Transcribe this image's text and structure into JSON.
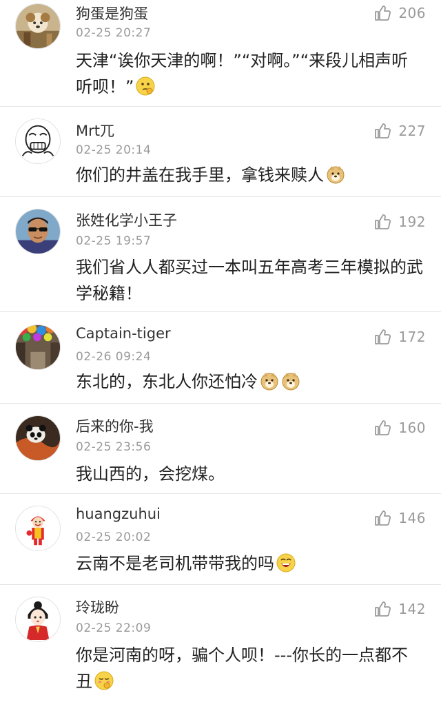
{
  "comments": [
    {
      "username": "狗蛋是狗蛋",
      "time": "02-25 20:27",
      "likes": "206",
      "avatar_icon": "dog-avatar-icon",
      "text": "天津“诶你天津的啊！”“对啊。”“来段儿相声听听呗！”",
      "emoji": "thinking-emoji-icon"
    },
    {
      "username": "Mrt兀",
      "time": "02-25 20:14",
      "likes": "227",
      "avatar_icon": "meme-face-avatar-icon",
      "text": "你们的井盖在我手里，拿钱来赎人",
      "emoji": "doge-emoji-icon"
    },
    {
      "username": "张姓化学小王子",
      "time": "02-25 19:57",
      "likes": "192",
      "avatar_icon": "sunglasses-man-avatar-icon",
      "text": "我们省人人都买过一本叫五年高考三年模拟的武学秘籍！",
      "emoji": ""
    },
    {
      "username": "Captain-tiger",
      "time": "02-26 09:24",
      "likes": "172",
      "avatar_icon": "umbrella-street-avatar-icon",
      "text": "东北的，东北人你还怕冷",
      "emoji": "doge-emoji-icon",
      "emoji_count": 2
    },
    {
      "username": "后来的你-我",
      "time": "02-25 23:56",
      "likes": "160",
      "avatar_icon": "panda-avatar-icon",
      "text": "我山西的，会挖煤。",
      "emoji": ""
    },
    {
      "username": "huangzuhui",
      "time": "02-25 20:02",
      "likes": "146",
      "avatar_icon": "cartoon-clown-avatar-icon",
      "text": "云南不是老司机带带我的吗",
      "emoji": "laughing-emoji-icon"
    },
    {
      "username": "玲珑盼",
      "time": "02-25 22:09",
      "likes": "142",
      "avatar_icon": "cartoon-girl-avatar-icon",
      "text": "你是河南的呀，骗个人呗！---你长的一点都不丑",
      "emoji": "shy-emoji-icon"
    }
  ],
  "colors": {
    "username": "#333333",
    "meta": "#9a9a9a",
    "body_text": "#222222",
    "divider": "#e6e6e6"
  }
}
